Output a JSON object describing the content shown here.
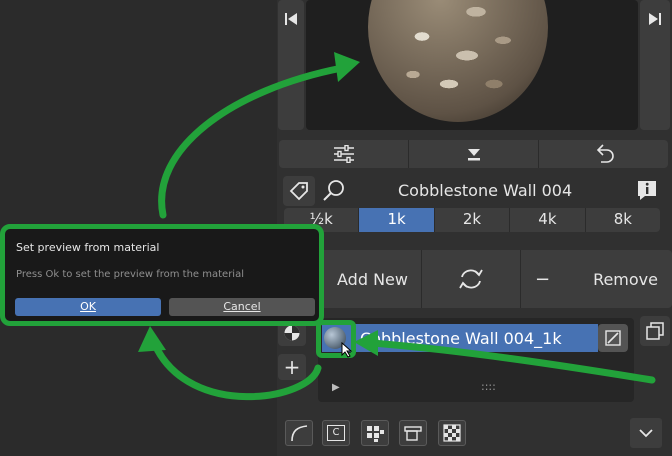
{
  "colors": {
    "accent": "#4772b3",
    "highlight_green": "#22a23a",
    "panel": "#303030",
    "button": "#3d3d3d"
  },
  "preview": {
    "prev_icon": "skip-back-icon",
    "next_icon": "skip-forward-icon",
    "image": "cobblestone-sphere-preview"
  },
  "toolbar": {
    "filter_icon": "sliders-icon",
    "import_icon": "download-icon",
    "undo_icon": "undo-icon"
  },
  "asset": {
    "tag_icon": "tag-icon",
    "search_icon": "search-icon",
    "title": "Cobblestone Wall 004",
    "info_icon": "info-icon",
    "resolutions": [
      "½k",
      "1k",
      "2k",
      "4k",
      "8k"
    ],
    "selected_resolution": "1k"
  },
  "actions": {
    "add_new": "Add New",
    "refresh_icon": "refresh-icon",
    "remove_symbol": "−",
    "remove": "Remove"
  },
  "material_list": {
    "item_name": "Cobblestone Wall 004_1k",
    "item_icon": "material-sphere-icon",
    "edit_icon": "edit-icon",
    "copy_icon": "copy-icon",
    "shader_icon": "shader-sphere-icon",
    "add_symbol": "+",
    "expand_symbol": "▶",
    "grip": "::::"
  },
  "bottom_tools": [
    "curve-tool-icon",
    "c-tool-icon",
    "grid-tool-icon",
    "projector-tool-icon",
    "checker-tool-icon",
    "chevron-down-icon"
  ],
  "bottom_text": {
    "c_label": "C"
  },
  "dialog": {
    "title": "Set preview from material",
    "message": "Press Ok to set the preview from the material",
    "ok": "OK",
    "cancel": "Cancel"
  }
}
